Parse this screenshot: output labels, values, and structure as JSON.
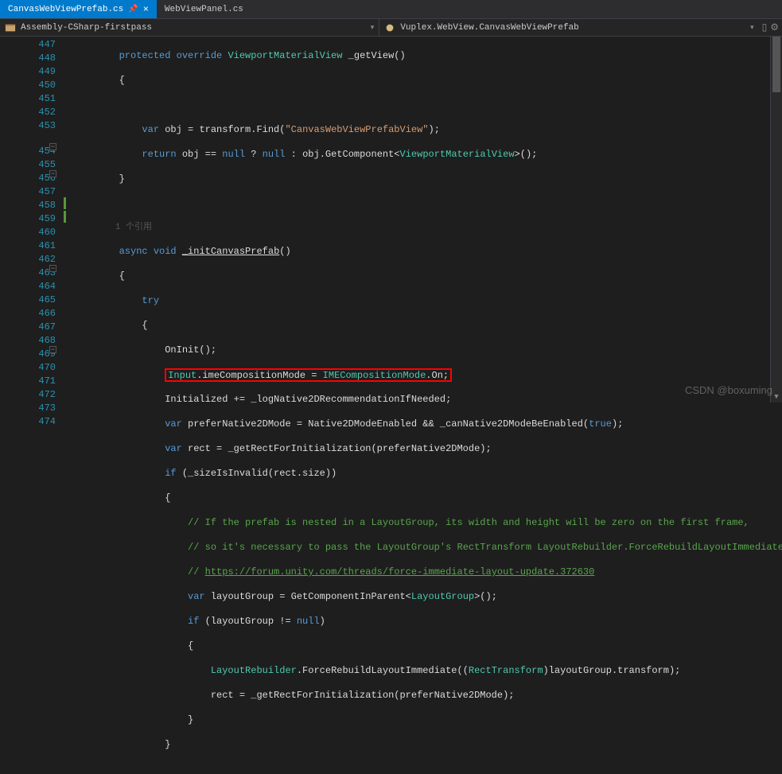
{
  "tabs": [
    {
      "label": "CanvasWebViewPrefab.cs",
      "active": true
    },
    {
      "label": "WebViewPanel.cs",
      "active": false
    }
  ],
  "nav": {
    "left": "Assembly-CSharp-firstpass",
    "right": "Vuplex.WebView.CanvasWebViewPrefab"
  },
  "watermark": "CSDN @boxuming",
  "code": {
    "ref_label": "1 个引用",
    "lines": [
      {
        "n": 447,
        "t": "        protected override ViewportMaterialView _getView()"
      },
      {
        "n": 448,
        "t": "        {"
      },
      {
        "n": 449,
        "t": ""
      },
      {
        "n": 450,
        "t": "            var obj = transform.Find(\"CanvasWebViewPrefabView\");"
      },
      {
        "n": 451,
        "t": "            return obj == null ? null : obj.GetComponent<ViewportMaterialView>();"
      },
      {
        "n": 452,
        "t": "        }"
      },
      {
        "n": 453,
        "t": ""
      },
      {
        "n": 454,
        "t": "        async void _initCanvasPrefab()"
      },
      {
        "n": 455,
        "t": "        {"
      },
      {
        "n": 456,
        "t": "            try"
      },
      {
        "n": 457,
        "t": "            {"
      },
      {
        "n": 458,
        "t": "                OnInit();"
      },
      {
        "n": 459,
        "t": "                Input.imeCompositionMode = IMECompositionMode.On;"
      },
      {
        "n": 460,
        "t": "                Initialized += _logNative2DRecommendationIfNeeded;"
      },
      {
        "n": 461,
        "t": "                var preferNative2DMode = Native2DModeEnabled && _canNative2DModeBeEnabled(true);"
      },
      {
        "n": 462,
        "t": "                var rect = _getRectForInitialization(preferNative2DMode);"
      },
      {
        "n": 463,
        "t": "                if (_sizeIsInvalid(rect.size))"
      },
      {
        "n": 464,
        "t": "                {"
      },
      {
        "n": 465,
        "t": "                    // If the prefab is nested in a LayoutGroup, its width and height will be zero on the first frame,"
      },
      {
        "n": 466,
        "t": "                    // so it's necessary to pass the LayoutGroup's RectTransform LayoutRebuilder.ForceRebuildLayoutImmediate()."
      },
      {
        "n": 467,
        "t": "                    // https://forum.unity.com/threads/force-immediate-layout-update.372630"
      },
      {
        "n": 468,
        "t": "                    var layoutGroup = GetComponentInParent<LayoutGroup>();"
      },
      {
        "n": 469,
        "t": "                    if (layoutGroup != null)"
      },
      {
        "n": 470,
        "t": "                    {"
      },
      {
        "n": 471,
        "t": "                        LayoutRebuilder.ForceRebuildLayoutImmediate((RectTransform)layoutGroup.transform);"
      },
      {
        "n": 472,
        "t": "                        rect = _getRectForInitialization(preferNative2DMode);"
      },
      {
        "n": 473,
        "t": "                    }"
      },
      {
        "n": 474,
        "t": "                }"
      }
    ]
  }
}
